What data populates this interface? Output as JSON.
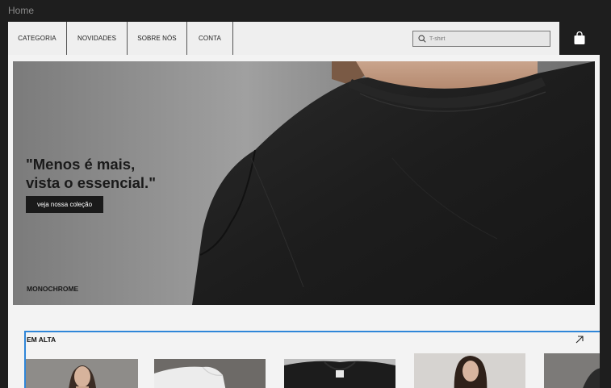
{
  "page": {
    "breadcrumb": "Home"
  },
  "nav": {
    "items": [
      {
        "label": "CATEGORIA"
      },
      {
        "label": "NOVIDADES"
      },
      {
        "label": "SOBRE NÓS"
      },
      {
        "label": "CONTA"
      }
    ],
    "search": {
      "placeholder": "T-shirt",
      "icon": "search-icon"
    },
    "cart": {
      "icon": "shopping-bag-icon"
    }
  },
  "hero": {
    "headline_line1": "\"Menos é mais,",
    "headline_line2": "vista o essencial.\"",
    "cta_label": "veja nossa coleção",
    "brand": "MONOCHROME"
  },
  "trending": {
    "title": "EM ALTA",
    "arrow_icon": "arrow-up-right-icon",
    "products": [
      {
        "image": "woman in light top"
      },
      {
        "image": "white folded t-shirt"
      },
      {
        "image": "black t-shirt flat lay"
      },
      {
        "image": "woman with dark hair"
      },
      {
        "image": "grey product partial"
      }
    ]
  },
  "colors": {
    "accent_outline": "#2f86d8",
    "dark": "#1e1e1e",
    "surface": "#f3f3f3"
  }
}
